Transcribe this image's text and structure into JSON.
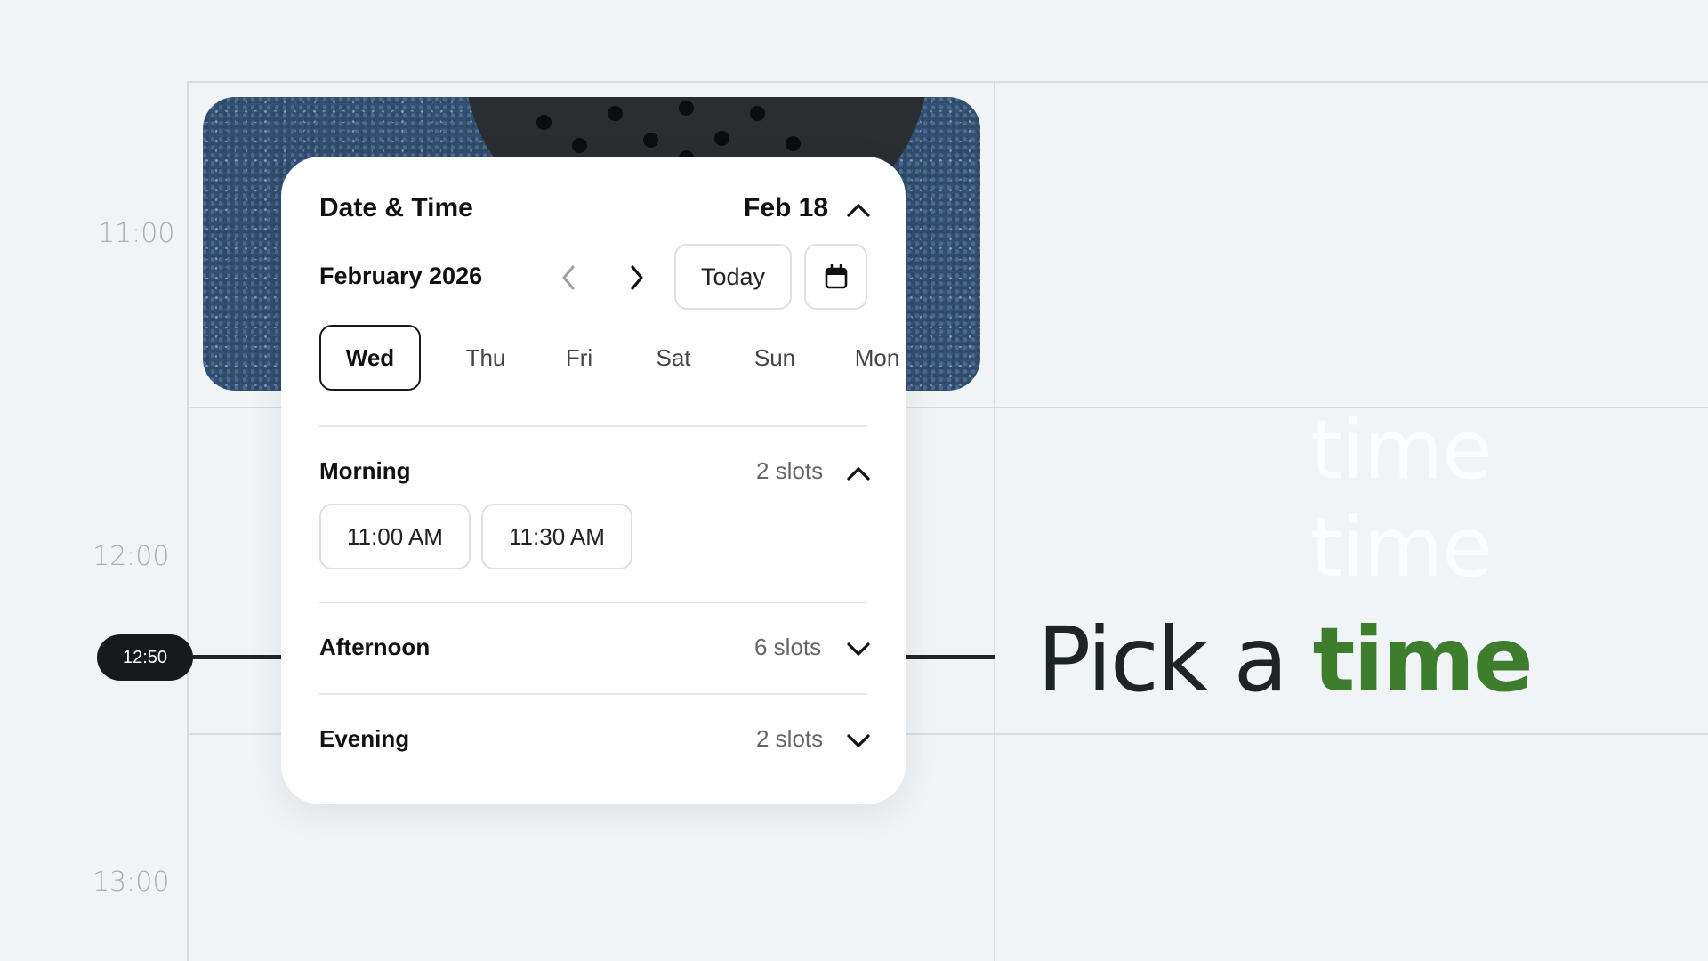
{
  "timeline": {
    "hours": [
      "11:00",
      "12:00",
      "13:00"
    ],
    "now": "12:50"
  },
  "popup": {
    "title": "Date & Time",
    "selected_date": "Feb 18",
    "month": "February 2026",
    "today_label": "Today",
    "days": [
      "Wed",
      "Thu",
      "Fri",
      "Sat",
      "Sun",
      "Mon"
    ],
    "selected_day": "Wed",
    "sections": [
      {
        "label": "Morning",
        "slots": "2 slots",
        "expanded": true,
        "times": [
          "11:00 AM",
          "11:30 AM"
        ]
      },
      {
        "label": "Afternoon",
        "slots": "6 slots",
        "expanded": false
      },
      {
        "label": "Evening",
        "slots": "2 slots",
        "expanded": false
      }
    ]
  },
  "hero": {
    "ghost_words": [
      "time",
      "time"
    ],
    "prefix": "Pick a",
    "accent": "time"
  },
  "colors": {
    "background": "#f0f4f7",
    "accent_green": "#3d7d2c",
    "dark": "#17191b"
  },
  "icons": [
    "chevron-up-icon",
    "chevron-left-icon",
    "chevron-right-icon",
    "calendar-icon",
    "chevron-down-icon"
  ]
}
